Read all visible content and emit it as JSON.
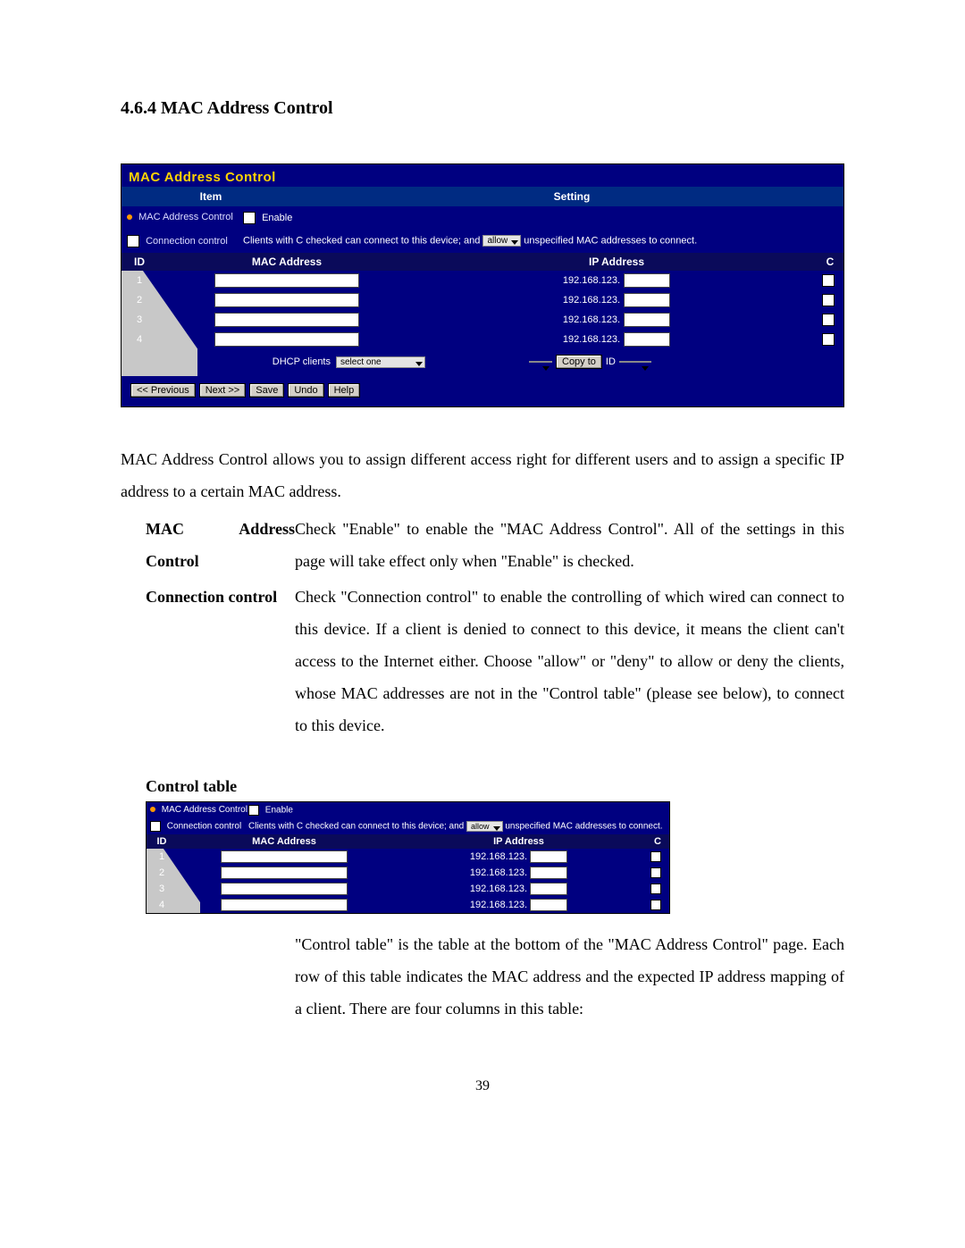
{
  "heading": "4.6.4 MAC Address Control",
  "panel": {
    "title": "MAC Address Control",
    "hdr_item": "Item",
    "hdr_setting": "Setting",
    "row1_label": "MAC Address Control",
    "row1_value": "Enable",
    "row2_label": "Connection control",
    "row2_pre": "Clients with C checked can connect to this device; and",
    "row2_select": "allow",
    "row2_post": "unspecified MAC addresses to connect.",
    "table_hdr_id": "ID",
    "table_hdr_mac": "MAC Address",
    "table_hdr_ip": "IP Address",
    "table_hdr_c": "C",
    "rows": [
      {
        "id": "1",
        "ip_prefix": "192.168.123."
      },
      {
        "id": "2",
        "ip_prefix": "192.168.123."
      },
      {
        "id": "3",
        "ip_prefix": "192.168.123."
      },
      {
        "id": "4",
        "ip_prefix": "192.168.123."
      }
    ],
    "dhcp_label": "DHCP clients",
    "dhcp_select": "select one",
    "copyto": "Copy to",
    "id_label": "ID",
    "buttons": {
      "prev": "<< Previous",
      "next": "Next >>",
      "save": "Save",
      "undo": "Undo",
      "help": "Help"
    }
  },
  "body_intro": "MAC Address Control allows you to assign different access right for different users and to assign a specific IP address to a certain MAC address.",
  "def1_term": "MAC Address Control",
  "def1_body": "Check \"Enable\" to enable the \"MAC Address Control\". All of the settings in this page will take effect only when \"Enable\" is checked.",
  "def2_term": "Connection control",
  "def2_body": "Check \"Connection control\" to enable the controlling of which wired can connect to this device. If a client is denied to connect to this device, it means the client can't access to the Internet either. Choose \"allow\" or \"deny\" to allow or deny the clients, whose MAC addresses are not in the \"Control table\" (please see below), to connect to this device.",
  "sub_title": "Control table",
  "mini": {
    "row1_label": "MAC Address Control",
    "row1_value": "Enable",
    "row2_label": "Connection control",
    "row2_pre": "Clients with C checked can connect to this device; and",
    "row2_select": "allow",
    "row2_post": "unspecified MAC addresses to connect.",
    "hdr_id": "ID",
    "hdr_mac": "MAC Address",
    "hdr_ip": "IP Address",
    "hdr_c": "C",
    "rows": [
      {
        "id": "1",
        "ip_prefix": "192.168.123."
      },
      {
        "id": "2",
        "ip_prefix": "192.168.123."
      },
      {
        "id": "3",
        "ip_prefix": "192.168.123."
      },
      {
        "id": "4",
        "ip_prefix": "192.168.123."
      }
    ]
  },
  "sub_body": "\"Control table\" is the table at the bottom of the \"MAC Address Control\" page. Each row of this table indicates the MAC address and the expected IP address mapping of a client. There are four columns in this table:",
  "page_number": "39"
}
